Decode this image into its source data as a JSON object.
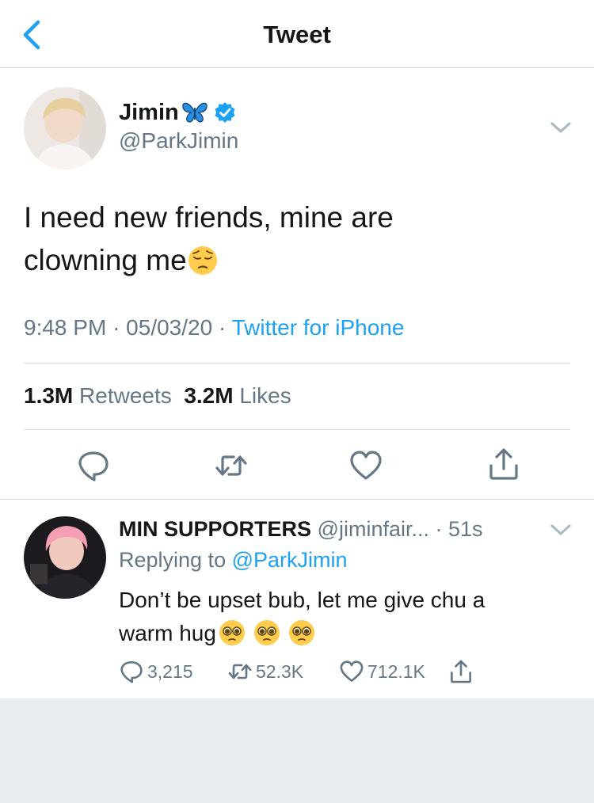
{
  "header": {
    "title": "Tweet"
  },
  "tweet": {
    "display_name": "Jimin",
    "handle": "@ParkJimin",
    "text_line1": "I need new friends, mine are",
    "text_line2": "clowning me",
    "time": "9:48 PM",
    "date": "05/03/20",
    "source": "Twitter for iPhone",
    "retweets_count": "1.3M",
    "retweets_label": "Retweets",
    "likes_count": "3.2M",
    "likes_label": "Likes"
  },
  "reply": {
    "display_name": "MIN SUPPORTERS",
    "handle": "@jiminfair...",
    "time": "51s",
    "replying_prefix": "Replying to",
    "replying_to": "@ParkJimin",
    "text_line1": "Don’t be upset bub, let me give chu a",
    "text_line2": "warm hug",
    "reply_count": "3,215",
    "retweet_count": "52.3K",
    "like_count": "712.1K"
  },
  "colors": {
    "accent": "#1da1f2",
    "muted": "#657786",
    "divider": "#d8dfe4",
    "background": "#e6ecf0"
  },
  "icons": [
    "back-chevron-icon",
    "butterfly-icon",
    "verified-badge-icon",
    "chevron-down-icon",
    "reply-icon",
    "retweet-icon",
    "like-icon",
    "share-icon",
    "pensive-face-emoji",
    "pleading-face-emoji"
  ]
}
